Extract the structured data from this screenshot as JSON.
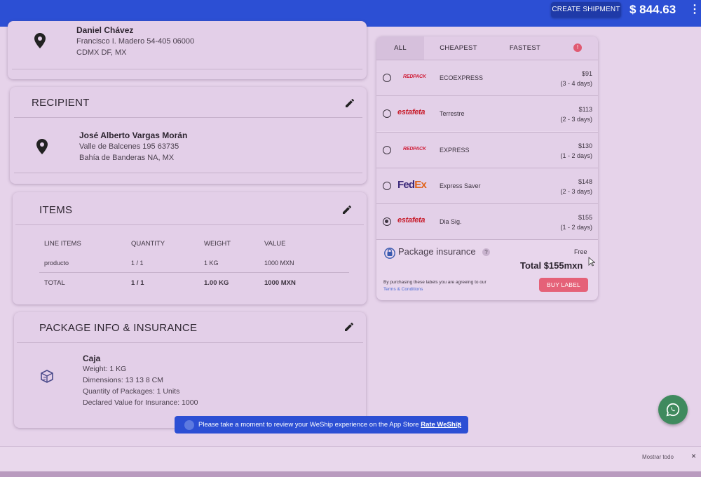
{
  "topbar": {
    "create_label": "CREATE SHIPMENT",
    "balance": "$ 844.63",
    "menu_glyph": "⋮"
  },
  "sender": {
    "name": "Daniel Chávez",
    "line1": "Francisco I. Madero 54-405 06000",
    "line2": "CDMX DF, MX"
  },
  "recipient": {
    "title": "RECIPIENT",
    "name": "José Alberto Vargas Morán",
    "line1": "Valle de Balcenes 195 63735",
    "line2": "Bahía de Banderas NA, MX"
  },
  "items": {
    "title": "ITEMS",
    "headers": [
      "LINE ITEMS",
      "QUANTITY",
      "WEIGHT",
      "VALUE"
    ],
    "row": [
      "producto",
      "1 / 1",
      "1 KG",
      "1000 MXN"
    ],
    "total": [
      "TOTAL",
      "1 / 1",
      "1.00 KG",
      "1000 MXN"
    ]
  },
  "package": {
    "title": "PACKAGE INFO & INSURANCE",
    "name": "Caja",
    "weight": "Weight: 1 KG",
    "dimensions": "Dimensions: 13 13 8 CM",
    "quantity": "Quantity of Packages: 1 Units",
    "declared": "Declared Value for Insurance: 1000"
  },
  "rates": {
    "tabs": [
      "ALL",
      "CHEAPEST",
      "FASTEST"
    ],
    "active_tab": "ALL",
    "badge": "!",
    "options": [
      {
        "carrier": "REDPACK",
        "service": "ECOEXPRESS",
        "price": "$91",
        "days": "(3 - 4 days)",
        "selected": false
      },
      {
        "carrier": "estafeta",
        "service": "Terrestre",
        "price": "$113",
        "days": "(2 - 3 days)",
        "selected": false
      },
      {
        "carrier": "REDPACK",
        "service": "EXPRESS",
        "price": "$130",
        "days": "(1 - 2 days)",
        "selected": false
      },
      {
        "carrier": "FedEx",
        "service": "Express Saver",
        "price": "$148",
        "days": "(2 - 3 days)",
        "selected": false
      },
      {
        "carrier": "estafeta",
        "service": "Dia Sig.",
        "price": "$155",
        "days": "(1 - 2 days)",
        "selected": true
      }
    ],
    "insurance_label": "Package insurance",
    "insurance_help": "?",
    "insurance_value": "Free",
    "total": "Total $155mxn",
    "terms_text": "By purchasing these labels you are agreeing to our",
    "terms_link": "Terms & Conditions",
    "buy_label": "BUY LABEL"
  },
  "banner": {
    "text": "Please take a moment to review your WeShip experience on the App Store",
    "link": "Rate WeShip",
    "close": "×"
  },
  "bottom": {
    "show_all": "Mostrar todo",
    "close": "×"
  },
  "colors": {
    "primary": "#2c4fd4",
    "background": "#e6d3ea",
    "buy": "#e56178",
    "whatsapp": "#3f8a5e"
  }
}
